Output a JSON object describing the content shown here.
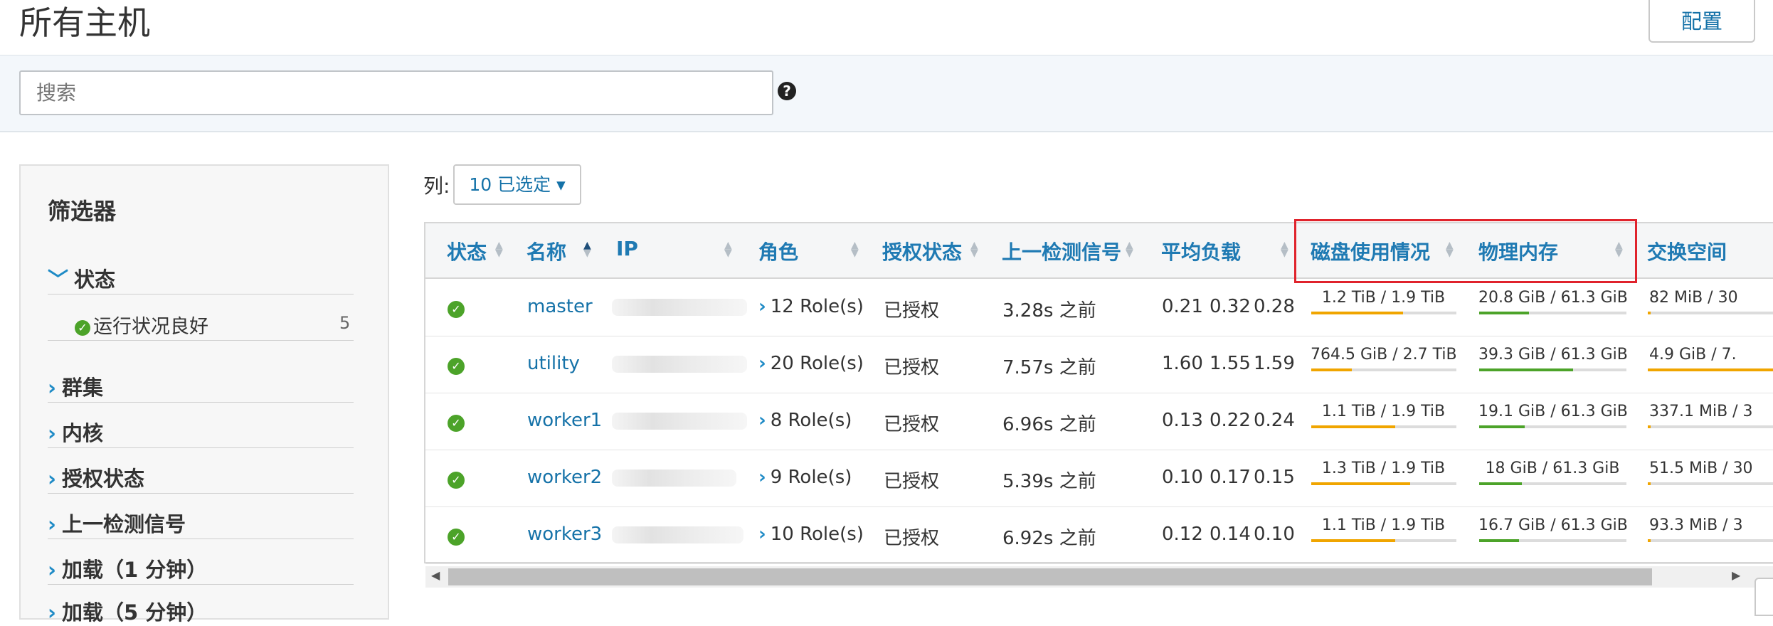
{
  "header": {
    "title": "所有主机",
    "config_label": "配置"
  },
  "search": {
    "placeholder": "搜索",
    "help_icon": "question-circle-icon"
  },
  "filters": {
    "title": "筛选器",
    "status_group": {
      "label": "状态",
      "item_label": "运行状况良好",
      "item_count": "5"
    },
    "groups": [
      "群集",
      "内核",
      "授权状态",
      "上一检测信号",
      "加载（1 分钟）",
      "加载（5 分钟）"
    ]
  },
  "columns": {
    "label": "列:",
    "selector_label": "10 已选定 ▾"
  },
  "table": {
    "headers": [
      "状态",
      "名称",
      "IP",
      "角色",
      "授权状态",
      "上一检测信号",
      "平均负载",
      "磁盘使用情况",
      "物理内存",
      "交换空间"
    ],
    "rows": [
      {
        "name": "master",
        "roles": "12 Role(s)",
        "auth": "已授权",
        "heartbeat": "3.28s 之前",
        "load": [
          "0.21",
          "0.32",
          "0.28"
        ],
        "disk": "1.2 TiB / 1.9 TiB",
        "disk_pct": 0.63,
        "mem": "20.8 GiB / 61.3 GiB",
        "mem_pct": 0.34,
        "swap": "82 MiB / 30"
      },
      {
        "name": "utility",
        "roles": "20 Role(s)",
        "auth": "已授权",
        "heartbeat": "7.57s 之前",
        "load": [
          "1.60",
          "1.55",
          "1.59"
        ],
        "disk": "764.5 GiB / 2.7 TiB",
        "disk_pct": 0.28,
        "mem": "39.3 GiB / 61.3 GiB",
        "mem_pct": 0.64,
        "swap": "4.9 GiB / 7."
      },
      {
        "name": "worker1",
        "roles": "8 Role(s)",
        "auth": "已授权",
        "heartbeat": "6.96s 之前",
        "load": [
          "0.13",
          "0.22",
          "0.24"
        ],
        "disk": "1.1 TiB / 1.9 TiB",
        "disk_pct": 0.58,
        "mem": "19.1 GiB / 61.3 GiB",
        "mem_pct": 0.31,
        "swap": "337.1 MiB / 3"
      },
      {
        "name": "worker2",
        "roles": "9 Role(s)",
        "auth": "已授权",
        "heartbeat": "5.39s 之前",
        "load": [
          "0.10",
          "0.17",
          "0.15"
        ],
        "disk": "1.3 TiB / 1.9 TiB",
        "disk_pct": 0.68,
        "mem": "18 GiB / 61.3 GiB",
        "mem_pct": 0.29,
        "swap": "51.5 MiB / 30"
      },
      {
        "name": "worker3",
        "roles": "10 Role(s)",
        "auth": "已授权",
        "heartbeat": "6.92s 之前",
        "load": [
          "0.12",
          "0.14",
          "0.10"
        ],
        "disk": "1.1 TiB / 1.9 TiB",
        "disk_pct": 0.58,
        "mem": "16.7 GiB / 61.3 GiB",
        "mem_pct": 0.27,
        "swap": "93.3 MiB / 3"
      }
    ]
  },
  "colors": {
    "accent": "#1572a8",
    "ok": "#4ca329",
    "disk_bar": "#f0a500",
    "mem_bar": "#4ca329",
    "swap_bar": "#f0a500",
    "highlight": "#e0232c"
  }
}
